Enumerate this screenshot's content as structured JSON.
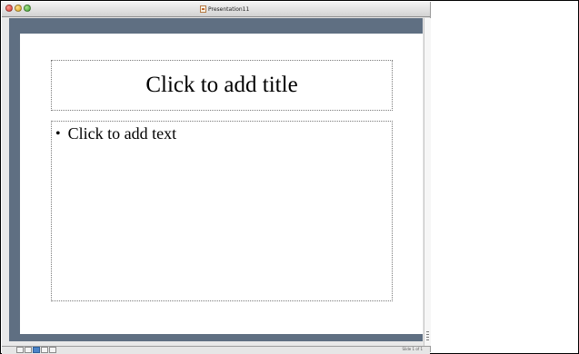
{
  "window": {
    "title": "Presentation11"
  },
  "slide": {
    "title_placeholder": "Click to add title",
    "bullet": "•",
    "body_placeholder": "Click to add text"
  },
  "status": {
    "slide_counter": "Slide 1 of 1"
  },
  "colors": {
    "pane_background": "#5f6f82",
    "slide_background": "#ffffff",
    "active_view_button": "#4b84c8"
  },
  "icons": {
    "close": "close-button-icon",
    "minimize": "minimize-button-icon",
    "zoom": "zoom-button-icon",
    "document": "presentation-document-icon",
    "resize": "resize-grip-icon"
  }
}
